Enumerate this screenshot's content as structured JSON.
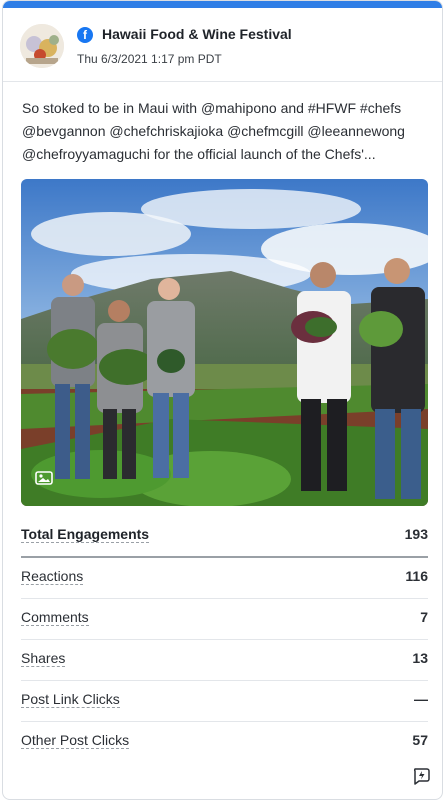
{
  "post": {
    "page_name": "Hawaii Food & Wine Festival",
    "timestamp": "Thu 6/3/2021 1:17 pm PDT",
    "caption": "So stoked to be in Maui with @mahipono and #HFWF #chefs @bevgannon @chefchriskajioka @chefmcgill @leeannewong @chefroyyamaguchi for the official launch of the Chefs'...",
    "network_icon": "facebook-icon",
    "accent_color": "#2f7ee6"
  },
  "metrics": [
    {
      "label": "Total Engagements",
      "value": "193"
    },
    {
      "label": "Reactions",
      "value": "116"
    },
    {
      "label": "Comments",
      "value": "7"
    },
    {
      "label": "Shares",
      "value": "13"
    },
    {
      "label": "Post Link Clicks",
      "value": "—"
    },
    {
      "label": "Other Post Clicks",
      "value": "57"
    }
  ]
}
